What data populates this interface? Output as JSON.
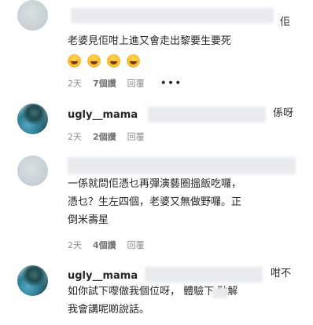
{
  "comments": [
    {
      "text_lines": [
        "佢",
        "老婆見佢咁上進又會走出黎要生要死"
      ],
      "emojis": [
        "grinning-squinting-tears-icon",
        "grinning-squinting-tears-icon",
        "grinning-squinting-tears-icon",
        "grinning-squinting-tears-icon"
      ],
      "time": "2天",
      "likes": "7個讚",
      "reply": "回覆",
      "more": "•••"
    },
    {
      "username": "ugly__mama",
      "text_tail": "係呀",
      "time": "2天",
      "likes": "2個讚",
      "reply": "回覆"
    },
    {
      "text_lines": [
        "一係就問佢憑乜再彈演藝圈搵飯吃囉，",
        "憑乜？生左四個，老婆又無做野囉。正",
        "倒米壽星"
      ],
      "time": "2天",
      "likes": "4個讚",
      "reply": "回覆"
    },
    {
      "username": "ugly__mama",
      "text_line1_tail": "咁不",
      "text_line2": "如你試下嚟做我個位呀， 體驗下 點解",
      "text_line3": "我會講呢啲說話。"
    }
  ]
}
